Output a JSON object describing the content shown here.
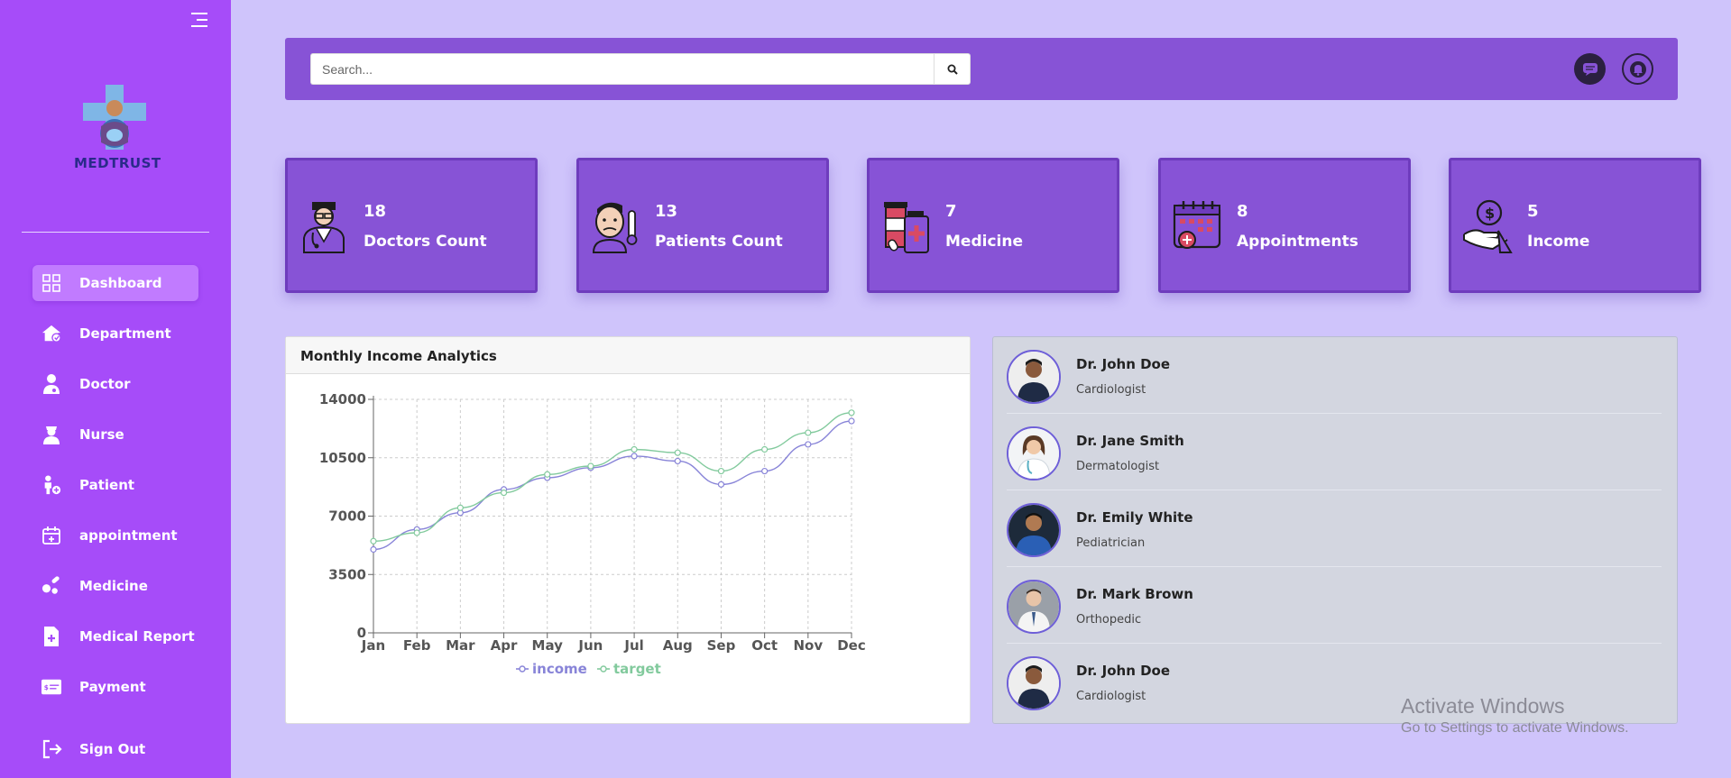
{
  "sidebar": {
    "logo_text": "MEDTRUST",
    "items": [
      {
        "label": "Dashboard",
        "icon": "grid-icon",
        "active": true
      },
      {
        "label": "Department",
        "icon": "hospital-icon",
        "active": false
      },
      {
        "label": "Doctor",
        "icon": "doctor-icon",
        "active": false
      },
      {
        "label": "Nurse",
        "icon": "nurse-icon",
        "active": false
      },
      {
        "label": "Patient",
        "icon": "patient-icon",
        "active": false
      },
      {
        "label": "appointment",
        "icon": "calendar-plus-icon",
        "active": false
      },
      {
        "label": "Medicine",
        "icon": "pills-icon",
        "active": false
      },
      {
        "label": "Medical Report",
        "icon": "file-medical-icon",
        "active": false
      },
      {
        "label": "Payment",
        "icon": "money-check-icon",
        "active": false
      }
    ],
    "signout_label": "Sign Out"
  },
  "topbar": {
    "search_placeholder": "Search...",
    "icons": [
      "search-icon",
      "message-icon",
      "bell-icon"
    ]
  },
  "cards": [
    {
      "value": "18",
      "label": "Doctors Count",
      "icon": "doctor-avatar-icon"
    },
    {
      "value": "13",
      "label": "Patients Count",
      "icon": "sick-patient-icon"
    },
    {
      "value": "7",
      "label": "Medicine",
      "icon": "medicine-bottles-icon"
    },
    {
      "value": "8",
      "label": "Appointments",
      "icon": "calendar-icon"
    },
    {
      "value": "5",
      "label": "Income",
      "icon": "hand-coin-icon"
    }
  ],
  "chart_panel": {
    "title": "Monthly Income Analytics"
  },
  "chart_data": {
    "type": "line",
    "x": [
      "Jan",
      "Feb",
      "Mar",
      "Apr",
      "May",
      "Jun",
      "Jul",
      "Aug",
      "Sep",
      "Oct",
      "Nov",
      "Dec"
    ],
    "yticks": [
      "0",
      "3500",
      "7000",
      "10500",
      "14000"
    ],
    "ylim": [
      0,
      14000
    ],
    "grid": true,
    "legend": "bottom",
    "series": [
      {
        "name": "income",
        "color": "#8884d8",
        "values": [
          5000,
          6200,
          7200,
          8600,
          9300,
          9900,
          10600,
          10300,
          8900,
          9700,
          11300,
          12700
        ]
      },
      {
        "name": "target",
        "color": "#82ca9d",
        "values": [
          5500,
          6000,
          7500,
          8400,
          9500,
          10000,
          11000,
          10800,
          9700,
          11000,
          12000,
          13200
        ]
      }
    ]
  },
  "doctors": [
    {
      "name": "Dr. John Doe",
      "specialty": "Cardiologist"
    },
    {
      "name": "Dr. Jane Smith",
      "specialty": "Dermatologist"
    },
    {
      "name": "Dr. Emily White",
      "specialty": "Pediatrician"
    },
    {
      "name": "Dr. Mark Brown",
      "specialty": "Orthopedic"
    },
    {
      "name": "Dr. John Doe",
      "specialty": "Cardiologist"
    }
  ],
  "watermark": {
    "title": "Activate Windows",
    "subtitle": "Go to Settings to activate Windows."
  },
  "colors": {
    "sidebar": "#a64cf9",
    "topbar": "#8753d6",
    "background": "#cfc4fb",
    "active_item": "#c17bff"
  }
}
